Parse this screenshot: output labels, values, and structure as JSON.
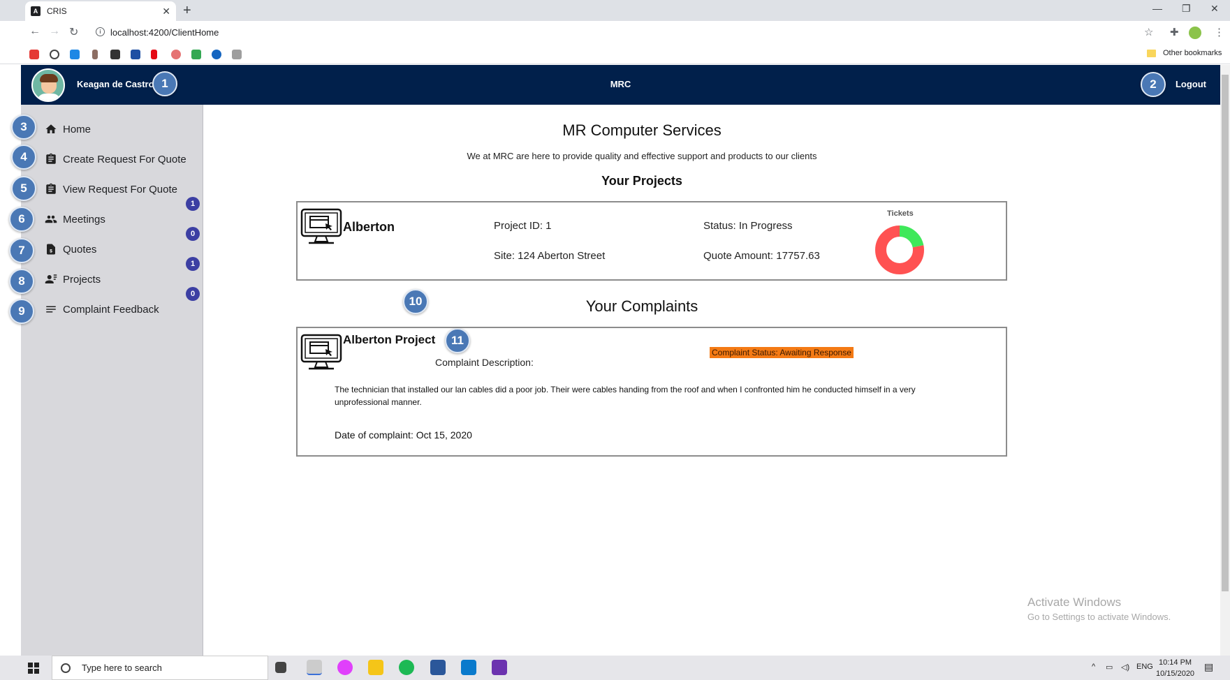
{
  "browser": {
    "tab_title": "CRIS",
    "tab_close": "✕",
    "new_tab": "+",
    "url": "localhost:4200/ClientHome",
    "other_bookmarks": "Other bookmarks",
    "window_controls": [
      "—",
      "❐",
      "✕"
    ],
    "bookmark_icons": [
      "youtube-icon",
      "speedometer-icon",
      "play-store-icon",
      "bookmark-icon-4",
      "bookmark-icon-5",
      "bookmark-icon-6",
      "netflix-icon",
      "bookmark-icon-8",
      "google-drive-icon",
      "bookmark-icon-10",
      "bookmark-icon-11"
    ]
  },
  "header": {
    "user_name": "Keagan de Castro",
    "brand": "MRC",
    "logout": "Logout"
  },
  "callouts": [
    "1",
    "2",
    "3",
    "4",
    "5",
    "6",
    "7",
    "8",
    "9",
    "10",
    "11"
  ],
  "sidebar": {
    "items": [
      {
        "label": "Home",
        "icon": "home-icon"
      },
      {
        "label": "Create Request For Quote",
        "icon": "clipboard-icon"
      },
      {
        "label": "View Request For Quote",
        "icon": "clipboard-icon"
      },
      {
        "label": "Meetings",
        "icon": "people-icon"
      },
      {
        "label": "Quotes",
        "icon": "quote-document-icon"
      },
      {
        "label": "Projects",
        "icon": "project-person-icon"
      },
      {
        "label": "Complaint Feedback",
        "icon": "list-lines-icon"
      }
    ],
    "counts": [
      "1",
      "0",
      "1",
      "0"
    ]
  },
  "main": {
    "company_title": "MR Computer Services",
    "company_subtitle": "We at MRC are here to provide quality and effective support and products to our clients",
    "projects_heading": "Your Projects",
    "project": {
      "name": "Alberton",
      "project_id": "Project ID: 1",
      "site": "Site: 124 Aberton Street",
      "status": "Status: In Progress",
      "quote_amount": "Quote Amount: 17757.63",
      "tickets_title": "Tickets",
      "tickets_chart": {
        "slices": [
          {
            "color": "#ff5252",
            "fraction": 0.78
          },
          {
            "color": "#3fe85a",
            "fraction": 0.22
          }
        ]
      }
    },
    "complaints_heading": "Your Complaints",
    "complaint": {
      "project_name": "Alberton Project",
      "status": "Complaint Status: Awaiting Response",
      "description_label": "Complaint Description:",
      "description": "The technician that installed our lan cables did a poor job. Their were cables handing from the roof and when I confronted him he conducted himself in a very unprofessional manner.",
      "date": "Date of complaint: Oct 15, 2020"
    }
  },
  "watermark": {
    "line1": "Activate Windows",
    "line2": "Go to Settings to activate Windows."
  },
  "taskbar": {
    "search_placeholder": "Type here to search",
    "language": "ENG",
    "time": "10:14 PM",
    "date": "10/15/2020"
  }
}
